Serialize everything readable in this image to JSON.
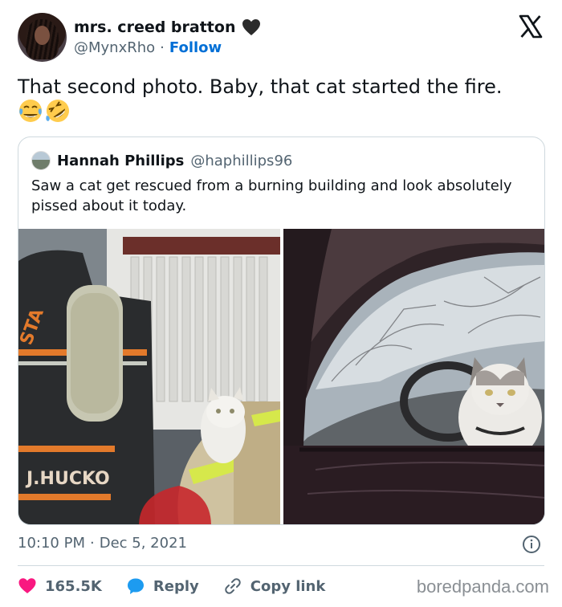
{
  "author": {
    "display_name": "mrs. creed bratton",
    "handle": "@MynxRho",
    "separator": "·",
    "follow_label": "Follow"
  },
  "tweet": {
    "text": "That second photo. Baby, that cat started the fire.",
    "emojis": [
      "face-with-tears-of-joy",
      "rolling-on-floor-laughing"
    ]
  },
  "quoted_tweet": {
    "display_name": "Hannah Phillips",
    "handle": "@haphillips96",
    "text": "Saw a cat get rescued from a burning building and look absolutely pissed about it today.",
    "photos": [
      {
        "description": "firefighter holding white cat",
        "gear_text_1": "STA",
        "gear_text_2": "J.HUCKO"
      },
      {
        "description": "white cat sitting in driver seat of car"
      }
    ]
  },
  "meta": {
    "time": "10:10 PM",
    "separator": "·",
    "date": "Dec 5, 2021"
  },
  "actions": {
    "likes": "165.5K",
    "reply_label": "Reply",
    "copy_link_label": "Copy link"
  },
  "watermark": "boredpanda.com",
  "colors": {
    "accent": "#006fd6",
    "heart": "#f91880",
    "reply_bubble": "#1d9bf0",
    "secondary_text": "#536471",
    "border": "#cfd9de"
  }
}
